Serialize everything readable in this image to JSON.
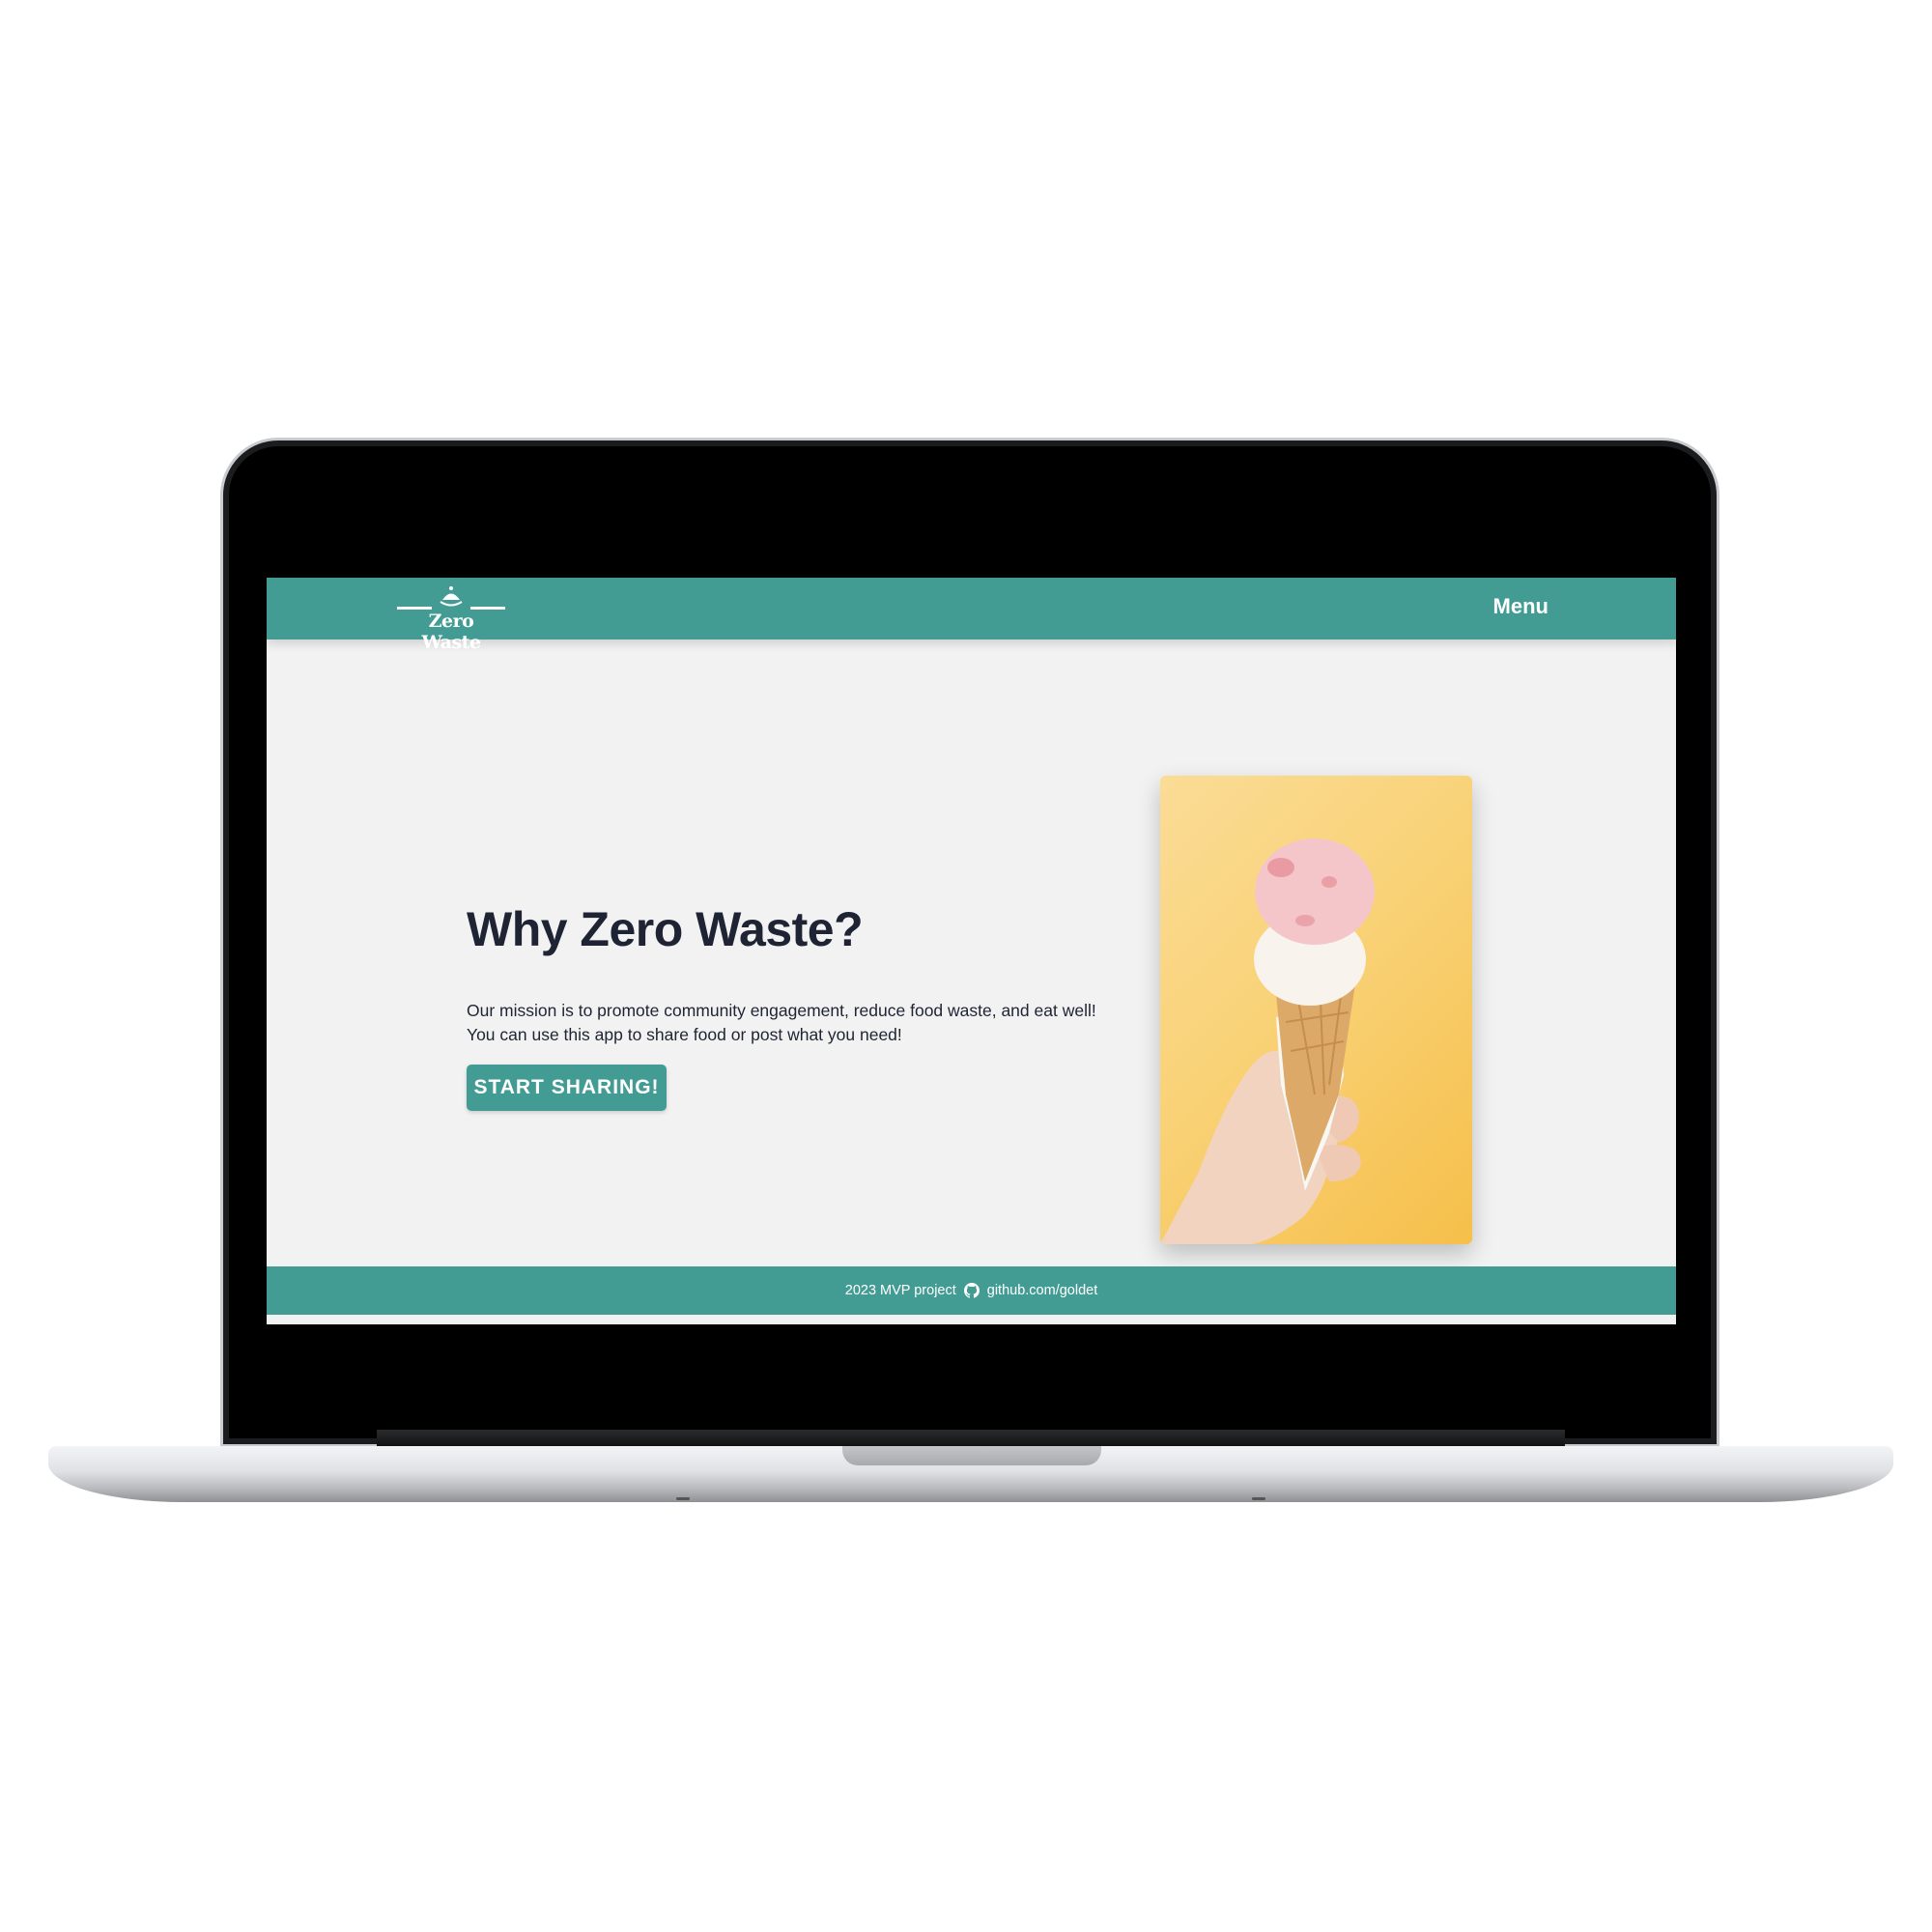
{
  "navbar": {
    "logo_text": "Zero Waste",
    "menu_label": "Menu"
  },
  "hero": {
    "title": "Why Zero Waste?",
    "line1": "Our mission is to promote community engagement, reduce food waste, and eat well!",
    "line2": "You can use this app to share food or post what you need!",
    "cta_label": "START SHARING!",
    "image_alt": "ice-cream-cone-photo"
  },
  "footer": {
    "project_text": "2023 MVP project",
    "github_link": "github.com/goldet",
    "icon": "github-icon"
  },
  "colors": {
    "brand_teal": "#439c94",
    "background": "#f2f2f2",
    "heading_text": "#1e2433"
  }
}
